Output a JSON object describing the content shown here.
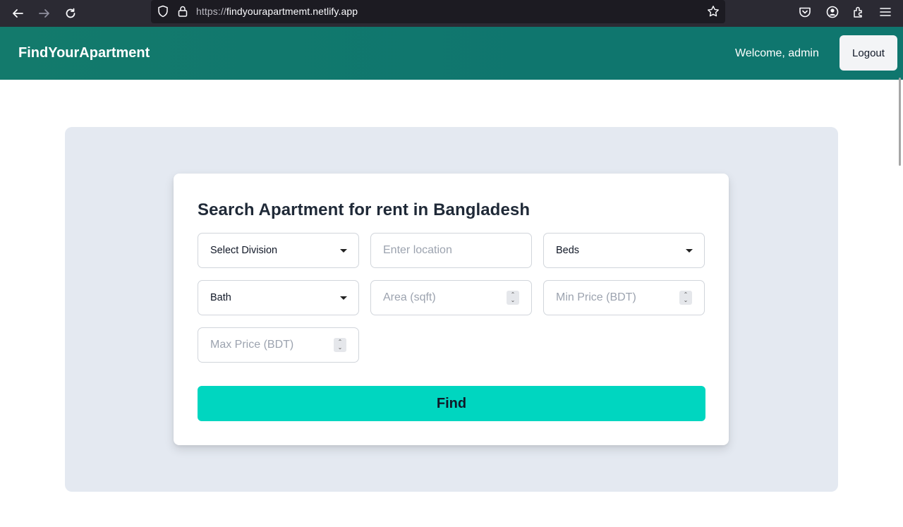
{
  "browser": {
    "url_protocol": "https://",
    "url_host": "findyourapartmemt.netlify.app",
    "icons": [
      "back-arrow-icon",
      "forward-arrow-icon",
      "reload-icon",
      "shield-icon",
      "lock-icon",
      "star-icon",
      "pocket-icon",
      "account-icon",
      "extensions-icon",
      "menu-icon"
    ]
  },
  "header": {
    "brand": "FindYourApartment",
    "welcome": "Welcome, admin",
    "logout_label": "Logout"
  },
  "search": {
    "title": "Search Apartment for rent in Bangladesh",
    "division_select": "Select Division",
    "location_placeholder": "Enter location",
    "beds_select": "Beds",
    "bath_select": "Bath",
    "area_placeholder": "Area (sqft)",
    "min_price_placeholder": "Min Price (BDT)",
    "max_price_placeholder": "Max Price (BDT)",
    "find_label": "Find"
  },
  "colors": {
    "header_bg": "#0f766e",
    "find_button": "#00d6c0",
    "panel_bg": "#e4e9f1"
  }
}
